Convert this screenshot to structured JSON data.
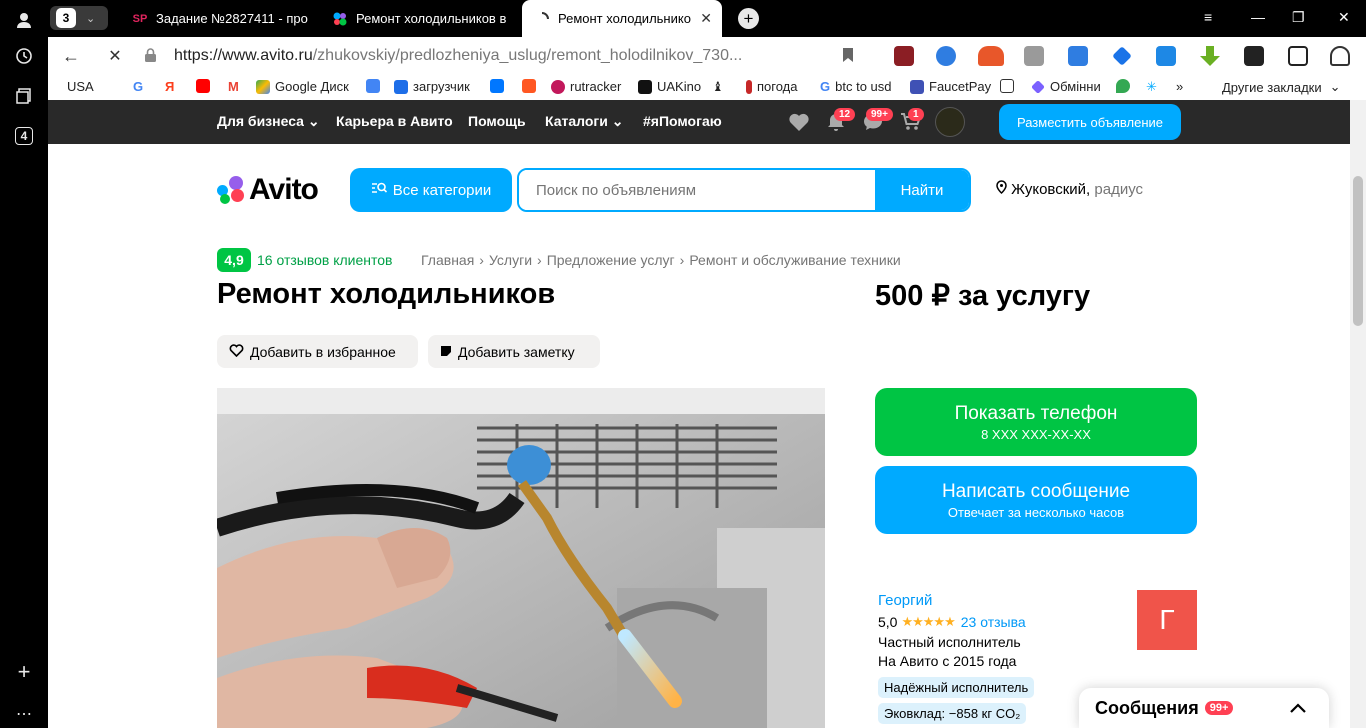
{
  "browser": {
    "tab_count": "3",
    "tabs": [
      {
        "label": "Задание №2827411 - про",
        "favicon": "SP"
      },
      {
        "label": "Ремонт холодильников в",
        "favicon": ""
      },
      {
        "label": "Ремонт холодильнико",
        "favicon": ""
      }
    ],
    "url_host": "https://www.avito.ru",
    "url_path": "/zhukovskiy/predlozheniya_uslug/remont_holodilnikov_730...",
    "sidebar_badge": "4",
    "bookmarks": [
      "USA",
      "Google Диск",
      "загрузчик",
      "rutracker",
      "UAKino",
      "погода",
      "btc to usd",
      "FaucetPay",
      "Обмінни",
      "Другие закладки"
    ]
  },
  "topbar": {
    "nav": [
      "Для бизнеса",
      "Карьера в Авито",
      "Помощь",
      "Каталоги",
      "#яПомогаю"
    ],
    "notif_badge": "12",
    "messages_badge": "99+",
    "cart_badge": "1",
    "post_button": "Разместить объявление"
  },
  "header": {
    "logo_text": "Avito",
    "categories_button": "Все категории",
    "search_placeholder": "Поиск по объявлениям",
    "search_button": "Найти",
    "location": "Жуковский,",
    "location_radius": "радиус"
  },
  "listing": {
    "rating": "4,9",
    "reviews_link": "16 отзывов клиентов",
    "breadcrumbs": [
      "Главная",
      "Услуги",
      "Предложение услуг",
      "Ремонт и обслуживание техники"
    ],
    "title": "Ремонт холодильников",
    "price": "500 ₽ за услугу",
    "favorite_button": "Добавить в избранное",
    "note_button": "Добавить заметку"
  },
  "contact": {
    "phone_button": "Показать телефон",
    "phone_mask": "8 XXX XXX-XX-XX",
    "message_button": "Написать сообщение",
    "message_sub": "Отвечает за несколько часов"
  },
  "seller": {
    "name": "Георгий",
    "rating": "5,0",
    "stars": "★★★★★",
    "reviews": "23 отзыва",
    "type": "Частный исполнитель",
    "since": "На Авито с 2015 года",
    "avatar_letter": "Г",
    "tags": [
      "Надёжный исполнитель",
      "Эковклад: −858 кг CO₂"
    ]
  },
  "messenger": {
    "title": "Сообщения",
    "badge": "99+"
  },
  "colors": {
    "avito_blue": "#00aaff",
    "avito_green": "#00c544",
    "badge_red": "#ff4053",
    "dark_bar": "#292929"
  }
}
